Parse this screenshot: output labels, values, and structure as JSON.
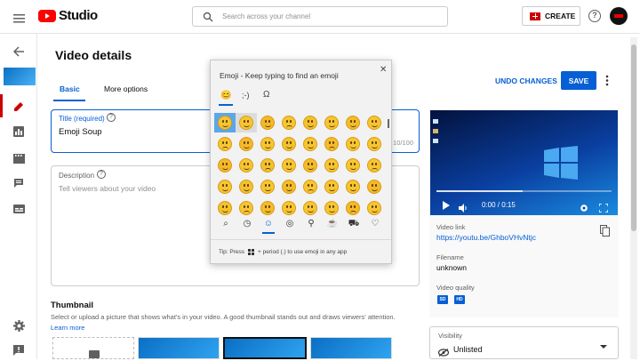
{
  "topbar": {
    "logo_text": "Studio",
    "search_placeholder": "Search across your channel",
    "create_label": "CREATE"
  },
  "page": {
    "title": "Video details",
    "tabs": [
      {
        "label": "Basic",
        "active": true
      },
      {
        "label": "More options",
        "active": false
      }
    ],
    "undo_label": "UNDO CHANGES",
    "save_label": "SAVE"
  },
  "title_field": {
    "label": "Title (required)",
    "value": "Emoji Soup",
    "counter": "10/100"
  },
  "description_field": {
    "label": "Description",
    "placeholder": "Tell viewers about your video"
  },
  "thumbnail": {
    "heading": "Thumbnail",
    "help_text": "Select or upload a picture that shows what's in your video. A good thumbnail stands out and draws viewers' attention.",
    "learn_more": "Learn more"
  },
  "emoji_panel": {
    "header": "Emoji - Keep typing to find an emoji",
    "top_tabs": [
      "😊",
      ";-)",
      "Ω"
    ],
    "categories": [
      "search",
      "recent",
      "smiley",
      "people",
      "celebration",
      "food",
      "travel",
      "heart"
    ],
    "tip_prefix": "Tip: Press",
    "tip_suffix": "+ period (.) to use emoji in any app"
  },
  "video_panel": {
    "time": "0:00 / 0:15",
    "link_label": "Video link",
    "link_value": "https://youtu.be/GhboVHvNtjc",
    "filename_label": "Filename",
    "filename_value": "unknown",
    "quality_label": "Video quality",
    "quality_badges": [
      "SD",
      "HD"
    ]
  },
  "visibility": {
    "label": "Visibility",
    "value": "Unlisted"
  },
  "colors": {
    "accent": "#065fd4",
    "brand_red": "#ff0000",
    "save_bg": "#065fd4"
  }
}
